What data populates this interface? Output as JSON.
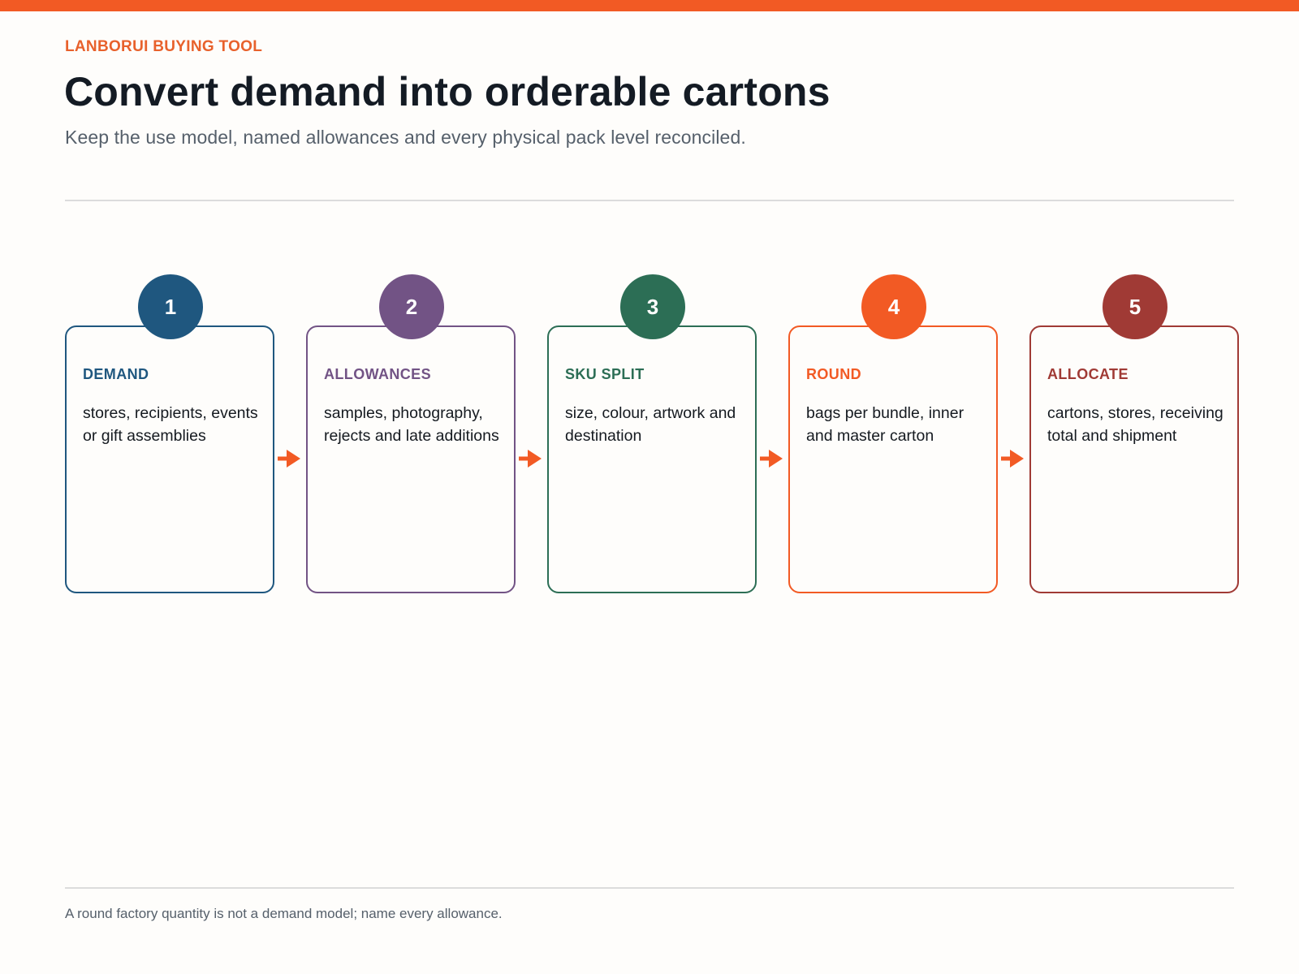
{
  "header": {
    "eyebrow": "LANBORUI BUYING TOOL",
    "title": "Convert demand into orderable cartons",
    "subtitle": "Keep the use model, named allowances and every physical pack level reconciled."
  },
  "steps": [
    {
      "number": "1",
      "title": "DEMAND",
      "body": "stores, recipients, events or gift assemblies",
      "color": "#1f577f"
    },
    {
      "number": "2",
      "title": "ALLOWANCES",
      "body": "samples, photography, rejects and late additions",
      "color": "#725385"
    },
    {
      "number": "3",
      "title": "SKU SPLIT",
      "body": "size, colour, artwork and destination",
      "color": "#2c6e55"
    },
    {
      "number": "4",
      "title": "ROUND",
      "body": "bags per bundle, inner and master carton",
      "color": "#f25a24"
    },
    {
      "number": "5",
      "title": "ALLOCATE",
      "body": "cartons, stores, receiving total and shipment",
      "color": "#a03a35"
    }
  ],
  "colors": {
    "accent": "#f25a24",
    "arrow": "#f25a24"
  },
  "footer": {
    "note": "A round factory quantity is not a demand model; name every allowance."
  }
}
